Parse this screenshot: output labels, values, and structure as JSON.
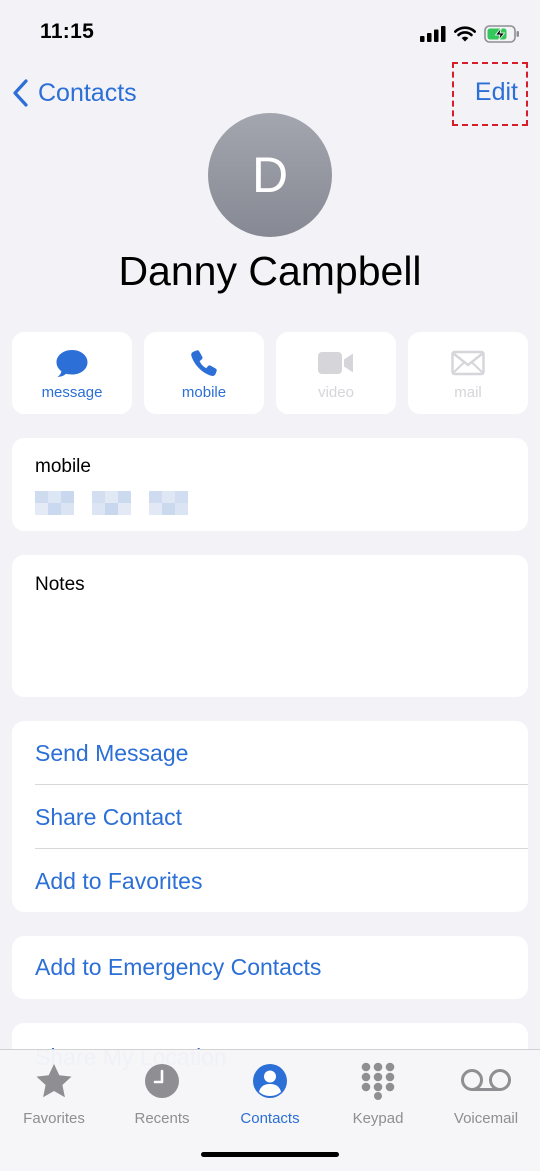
{
  "status_bar": {
    "time": "11:15"
  },
  "nav": {
    "back_label": "Contacts",
    "edit_label": "Edit"
  },
  "contact": {
    "initial": "D",
    "name": "Danny Campbell"
  },
  "actions": [
    {
      "label": "message",
      "enabled": true
    },
    {
      "label": "mobile",
      "enabled": true
    },
    {
      "label": "video",
      "enabled": false
    },
    {
      "label": "mail",
      "enabled": false
    }
  ],
  "phone": {
    "label": "mobile"
  },
  "notes": {
    "label": "Notes"
  },
  "action_list": [
    "Send Message",
    "Share Contact",
    "Add to Favorites"
  ],
  "emergency": "Add to Emergency Contacts",
  "share_partial": "Share My Location",
  "tabs": [
    {
      "label": "Favorites",
      "icon": "star-icon",
      "active": false
    },
    {
      "label": "Recents",
      "icon": "clock-icon",
      "active": false
    },
    {
      "label": "Contacts",
      "icon": "person-circle-icon",
      "active": true
    },
    {
      "label": "Keypad",
      "icon": "keypad-icon",
      "active": false
    },
    {
      "label": "Voicemail",
      "icon": "voicemail-icon",
      "active": false
    }
  ],
  "colors": {
    "accent": "#2c6fd6",
    "background": "#f2f2f7",
    "highlight_box": "#d81d2a"
  }
}
